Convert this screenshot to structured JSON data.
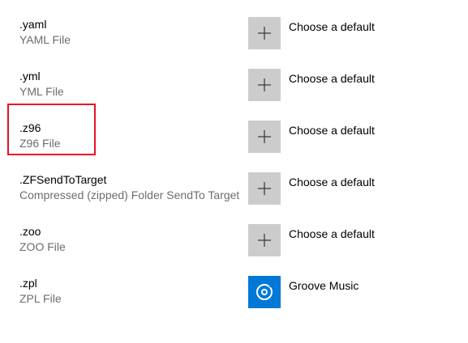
{
  "associations": [
    {
      "ext": ".yaml",
      "desc": "YAML File",
      "app": "Choose a default",
      "icon": "plus-icon"
    },
    {
      "ext": ".yml",
      "desc": "YML File",
      "app": "Choose a default",
      "icon": "plus-icon"
    },
    {
      "ext": ".z96",
      "desc": "Z96 File",
      "app": "Choose a default",
      "icon": "plus-icon"
    },
    {
      "ext": ".ZFSendToTarget",
      "desc": "Compressed (zipped) Folder SendTo Target",
      "app": "Choose a default",
      "icon": "plus-icon"
    },
    {
      "ext": ".zoo",
      "desc": "ZOO File",
      "app": "Choose a default",
      "icon": "plus-icon"
    },
    {
      "ext": ".zpl",
      "desc": "ZPL File",
      "app": "Groove Music",
      "icon": "groove-music-icon"
    }
  ],
  "colors": {
    "placeholder_tile": "#cccccc",
    "groove_tile": "#0078d7",
    "highlight_border": "#e81123",
    "secondary_text": "#6d6d6d"
  }
}
